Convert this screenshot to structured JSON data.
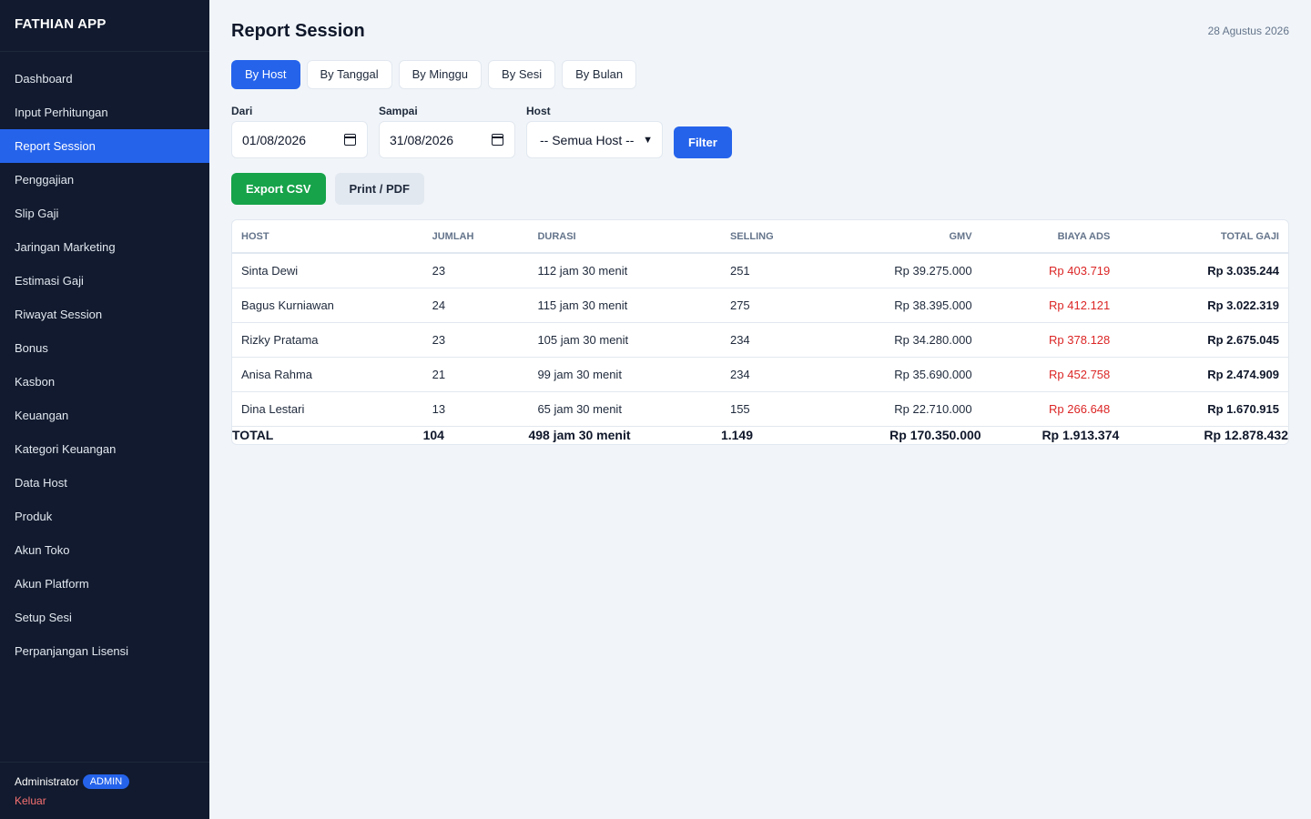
{
  "app": {
    "title": "FATHIAN APP"
  },
  "sidebar": {
    "items": [
      {
        "label": "Dashboard"
      },
      {
        "label": "Input Perhitungan"
      },
      {
        "label": "Report Session",
        "active": true
      },
      {
        "label": "Penggajian"
      },
      {
        "label": "Slip Gaji"
      },
      {
        "label": "Jaringan Marketing"
      },
      {
        "label": "Estimasi Gaji"
      },
      {
        "label": "Riwayat Session"
      },
      {
        "label": "Bonus"
      },
      {
        "label": "Kasbon"
      },
      {
        "label": "Keuangan"
      },
      {
        "label": "Kategori Keuangan"
      },
      {
        "label": "Data Host"
      },
      {
        "label": "Produk"
      },
      {
        "label": "Akun Toko"
      },
      {
        "label": "Akun Platform"
      },
      {
        "label": "Setup Sesi"
      },
      {
        "label": "Perpanjangan Lisensi"
      }
    ],
    "user": {
      "name": "Administrator",
      "role": "ADMIN",
      "logout": "Keluar"
    }
  },
  "header": {
    "title": "Report Session",
    "date": "28 Agustus 2026"
  },
  "tabs": [
    {
      "label": "By Host",
      "active": true
    },
    {
      "label": "By Tanggal"
    },
    {
      "label": "By Minggu"
    },
    {
      "label": "By Sesi"
    },
    {
      "label": "By Bulan"
    }
  ],
  "filters": {
    "from_label": "Dari",
    "from_value": "01/08/2026",
    "to_label": "Sampai",
    "to_value": "31/08/2026",
    "host_label": "Host",
    "host_value": "-- Semua Host --",
    "filter_button": "Filter"
  },
  "actions": {
    "export": "Export CSV",
    "print": "Print / PDF"
  },
  "table": {
    "columns": [
      "HOST",
      "JUMLAH",
      "DURASI",
      "SELLING",
      "GMV",
      "BIAYA ADS",
      "TOTAL GAJI"
    ],
    "rows": [
      {
        "host": "Sinta Dewi",
        "jumlah": "23",
        "durasi": "112 jam 30 menit",
        "selling": "251",
        "gmv": "Rp 39.275.000",
        "ads": "Rp 403.719",
        "gaji": "Rp 3.035.244"
      },
      {
        "host": "Bagus Kurniawan",
        "jumlah": "24",
        "durasi": "115 jam 30 menit",
        "selling": "275",
        "gmv": "Rp 38.395.000",
        "ads": "Rp 412.121",
        "gaji": "Rp 3.022.319"
      },
      {
        "host": "Rizky Pratama",
        "jumlah": "23",
        "durasi": "105 jam 30 menit",
        "selling": "234",
        "gmv": "Rp 34.280.000",
        "ads": "Rp 378.128",
        "gaji": "Rp 2.675.045"
      },
      {
        "host": "Anisa Rahma",
        "jumlah": "21",
        "durasi": "99 jam 30 menit",
        "selling": "234",
        "gmv": "Rp 35.690.000",
        "ads": "Rp 452.758",
        "gaji": "Rp 2.474.909"
      },
      {
        "host": "Dina Lestari",
        "jumlah": "13",
        "durasi": "65 jam 30 menit",
        "selling": "155",
        "gmv": "Rp 22.710.000",
        "ads": "Rp 266.648",
        "gaji": "Rp 1.670.915"
      }
    ],
    "total": {
      "label": "TOTAL",
      "jumlah": "104",
      "durasi": "498 jam 30 menit",
      "selling": "1.149",
      "gmv": "Rp 170.350.000",
      "ads": "Rp 1.913.374",
      "gaji": "Rp 12.878.432"
    }
  },
  "colors": {
    "sidebar_bg": "#111a2e",
    "accent": "#2563eb",
    "success": "#16a34a",
    "danger": "#dc2626"
  }
}
